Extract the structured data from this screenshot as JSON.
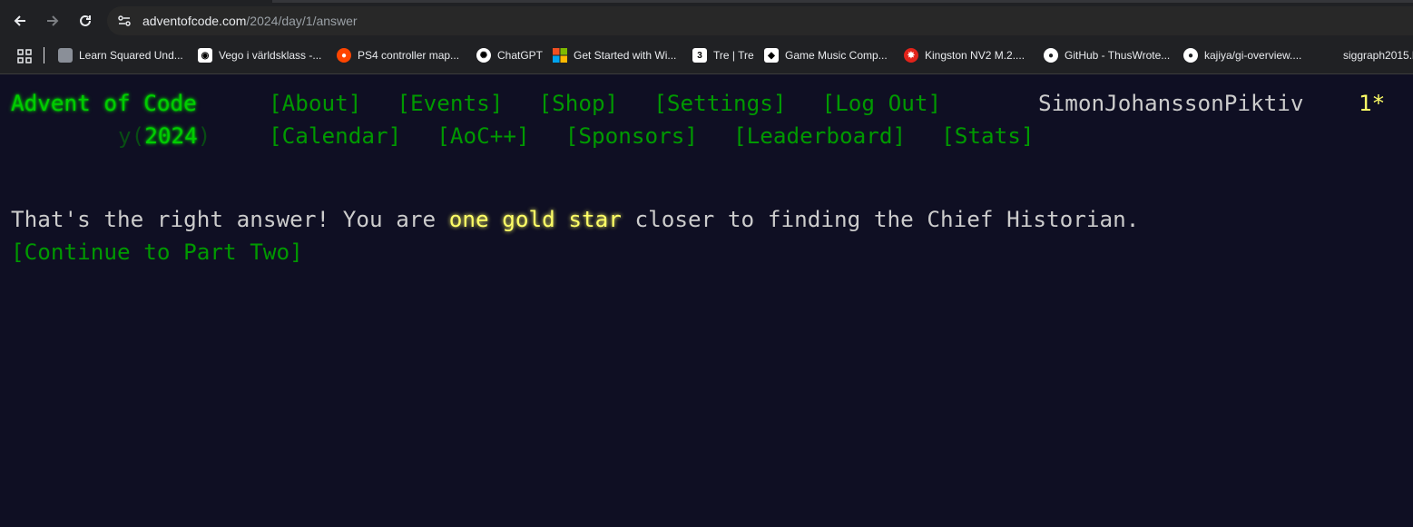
{
  "browser": {
    "url_domain": "adventofcode.com",
    "url_path": "/2024/day/1/answer"
  },
  "bookmarks": [
    {
      "label": "Learn Squared Und...",
      "icon": "cube-icon",
      "color": "#9aa0a6"
    },
    {
      "label": "Vego i världsklass -...",
      "icon": "site-icon",
      "color": "#ffffff"
    },
    {
      "label": "PS4 controller map...",
      "icon": "reddit-icon",
      "color": "#ff4500"
    },
    {
      "label": "ChatGPT",
      "icon": "chatgpt-icon",
      "color": "#ffffff"
    },
    {
      "label": "Get Started with Wi...",
      "icon": "microsoft-icon",
      "color": "#f25022"
    },
    {
      "label": "Tre | Tre",
      "icon": "tre-icon",
      "color": "#ffffff"
    },
    {
      "label": "Game Music Comp...",
      "icon": "diamond-icon",
      "color": "#ffffff"
    },
    {
      "label": "Kingston NV2 M.2....",
      "icon": "kingston-icon",
      "color": "#e2231a"
    },
    {
      "label": "GitHub - ThusWrote...",
      "icon": "github-icon",
      "color": "#ffffff"
    },
    {
      "label": "kajiya/gi-overview....",
      "icon": "github-icon",
      "color": "#ffffff"
    },
    {
      "label": "siggraph2015.l",
      "icon": "",
      "color": ""
    }
  ],
  "header": {
    "logo": "Advent of Code",
    "year_prefix": "y(",
    "year": "2024",
    "year_suffix": ")",
    "nav_row1": [
      "[About]",
      "[Events]",
      "[Shop]",
      "[Settings]",
      "[Log Out]"
    ],
    "nav_row2": [
      "[Calendar]",
      "[AoC++]",
      "[Sponsors]",
      "[Leaderboard]",
      "[Stats]"
    ],
    "username": "SimonJohanssonPiktiv",
    "stars": "1*"
  },
  "message": {
    "part1": "That's the right answer! You are ",
    "gold": "one gold star",
    "part2": " closer to finding the Chief Historian. ",
    "link": "[Continue to Part Two]"
  },
  "colors": {
    "background": "#0f0f23",
    "green": "#009900",
    "bright_green": "#00cc00",
    "gold": "#ffff66",
    "text": "#cccccc"
  }
}
